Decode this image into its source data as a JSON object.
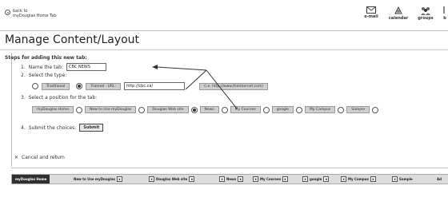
{
  "header": {
    "back_line1": "back to",
    "back_line2": "myDouglas Home Tab",
    "tools": [
      {
        "label": "e-mail",
        "icon": "envelope-icon"
      },
      {
        "label": "calendar",
        "icon": "calendar-icon"
      },
      {
        "label": "groups",
        "icon": "groups-icon"
      },
      {
        "label": "b",
        "icon": "more-icon"
      }
    ]
  },
  "page_title": "Manage Content/Layout",
  "form": {
    "heading": "Steps for adding this new tab:",
    "step1": {
      "num": "1.",
      "label": "Name the tab:",
      "value": "CBC NEWS"
    },
    "step2": {
      "num": "2.",
      "label": "Select the type:",
      "traditional": "Traditional",
      "framed": "Framed",
      "url_label": "URL:",
      "url_value": "http://cbc.ca/",
      "url_hint": "(i.e. http://www.theInternet.com)"
    },
    "step3": {
      "num": "3.",
      "label": "Select a position for the tab:",
      "positions": [
        "myDouglas Home",
        "New to Use myDouglas",
        "Douglas Web site",
        "News",
        "My Courses",
        "google",
        "My Campus",
        "Sample"
      ]
    },
    "step4": {
      "num": "4.",
      "label": "Submit the choices:",
      "button": "Submit"
    },
    "cancel": "Cancel and return"
  },
  "tabs": [
    "myDouglas Home",
    "New to Use myDouglas",
    "Douglas Web site",
    "News",
    "My Courses",
    "google",
    "My Campus",
    "Sample",
    "Ad"
  ]
}
